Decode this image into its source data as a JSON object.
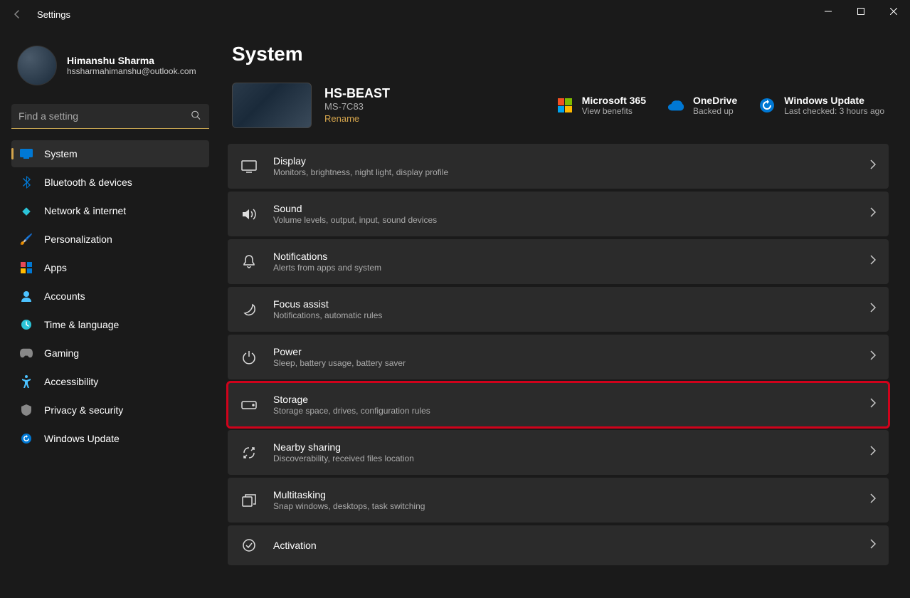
{
  "titlebar": {
    "title": "Settings"
  },
  "user": {
    "name": "Himanshu Sharma",
    "email": "hssharmahimanshu@outlook.com"
  },
  "search": {
    "placeholder": "Find a setting"
  },
  "nav": [
    {
      "id": "system",
      "label": "System",
      "active": true
    },
    {
      "id": "bluetooth",
      "label": "Bluetooth & devices"
    },
    {
      "id": "network",
      "label": "Network & internet"
    },
    {
      "id": "personalization",
      "label": "Personalization"
    },
    {
      "id": "apps",
      "label": "Apps"
    },
    {
      "id": "accounts",
      "label": "Accounts"
    },
    {
      "id": "time",
      "label": "Time & language"
    },
    {
      "id": "gaming",
      "label": "Gaming"
    },
    {
      "id": "accessibility",
      "label": "Accessibility"
    },
    {
      "id": "privacy",
      "label": "Privacy & security"
    },
    {
      "id": "update",
      "label": "Windows Update"
    }
  ],
  "page": {
    "title": "System"
  },
  "device": {
    "name": "HS-BEAST",
    "model": "MS-7C83",
    "rename": "Rename"
  },
  "tiles": {
    "ms365": {
      "title": "Microsoft 365",
      "sub": "View benefits"
    },
    "onedrive": {
      "title": "OneDrive",
      "sub": "Backed up"
    },
    "update": {
      "title": "Windows Update",
      "sub": "Last checked: 3 hours ago"
    }
  },
  "settings": [
    {
      "id": "display",
      "title": "Display",
      "desc": "Monitors, brightness, night light, display profile"
    },
    {
      "id": "sound",
      "title": "Sound",
      "desc": "Volume levels, output, input, sound devices"
    },
    {
      "id": "notifications",
      "title": "Notifications",
      "desc": "Alerts from apps and system"
    },
    {
      "id": "focus",
      "title": "Focus assist",
      "desc": "Notifications, automatic rules"
    },
    {
      "id": "power",
      "title": "Power",
      "desc": "Sleep, battery usage, battery saver"
    },
    {
      "id": "storage",
      "title": "Storage",
      "desc": "Storage space, drives, configuration rules",
      "highlighted": true
    },
    {
      "id": "nearby",
      "title": "Nearby sharing",
      "desc": "Discoverability, received files location"
    },
    {
      "id": "multitasking",
      "title": "Multitasking",
      "desc": "Snap windows, desktops, task switching"
    },
    {
      "id": "activation",
      "title": "Activation",
      "desc": ""
    }
  ]
}
